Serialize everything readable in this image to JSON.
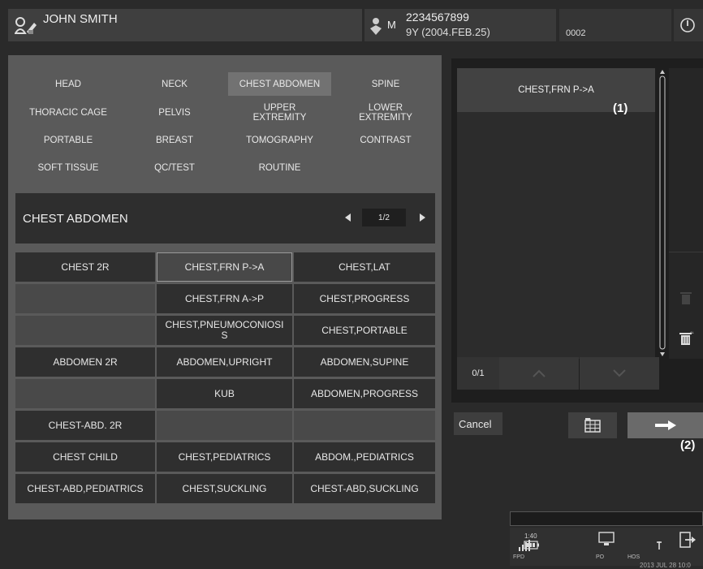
{
  "header": {
    "patient_name": "JOHN SMITH",
    "patient_id": "2234567899",
    "age_birth": "9Y (2004.FEB.25)",
    "code": "0002",
    "sex_mark": "M"
  },
  "categories": [
    "HEAD",
    "NECK",
    "CHEST ABDOMEN",
    "SPINE",
    "THORACIC CAGE",
    "PELVIS",
    "UPPER\nEXTREMITY",
    "LOWER\nEXTREMITY",
    "PORTABLE",
    "BREAST",
    "TOMOGRAPHY",
    "CONTRAST",
    "SOFT TISSUE",
    "QC/TEST",
    "ROUTINE",
    ""
  ],
  "selected_category": "CHEST ABDOMEN",
  "section": {
    "title": "CHEST ABDOMEN",
    "page": "1/2"
  },
  "exams": [
    [
      "CHEST 2R",
      "CHEST,FRN P->A",
      "CHEST,LAT"
    ],
    [
      "",
      "CHEST,FRN A->P",
      "CHEST,PROGRESS"
    ],
    [
      "",
      "CHEST,PNEUMOCONIOSIS",
      "CHEST,PORTABLE"
    ],
    [
      "ABDOMEN 2R",
      "ABDOMEN,UPRIGHT",
      "ABDOMEN,SUPINE"
    ],
    [
      "",
      "KUB",
      "ABDOMEN,PROGRESS"
    ],
    [
      "CHEST-ABD. 2R",
      "",
      ""
    ],
    [
      "CHEST CHILD",
      "CHEST,PEDIATRICS",
      "ABDOM.,PEDIATRICS"
    ],
    [
      "CHEST-ABD,PEDIATRICS",
      "CHEST,SUCKLING",
      "CHEST-ABD,SUCKLING"
    ]
  ],
  "exam_display": {
    "CHEST,PNEUMOCONIOSIS": "CHEST,PNEUMOCONIOSI\nS"
  },
  "selected_exam": "CHEST,FRN P->A",
  "selection": {
    "items": [
      "CHEST,FRN P->A"
    ],
    "count": "0/1",
    "callout": "(1)"
  },
  "actions": {
    "cancel_label": "Cancel",
    "callout": "(2)"
  },
  "status": {
    "fpd_label": "FPD",
    "po_label": "PO",
    "hos_label": "HOS",
    "battery_time": "1:40",
    "datetime": "2013 JUL 28 10:0"
  }
}
